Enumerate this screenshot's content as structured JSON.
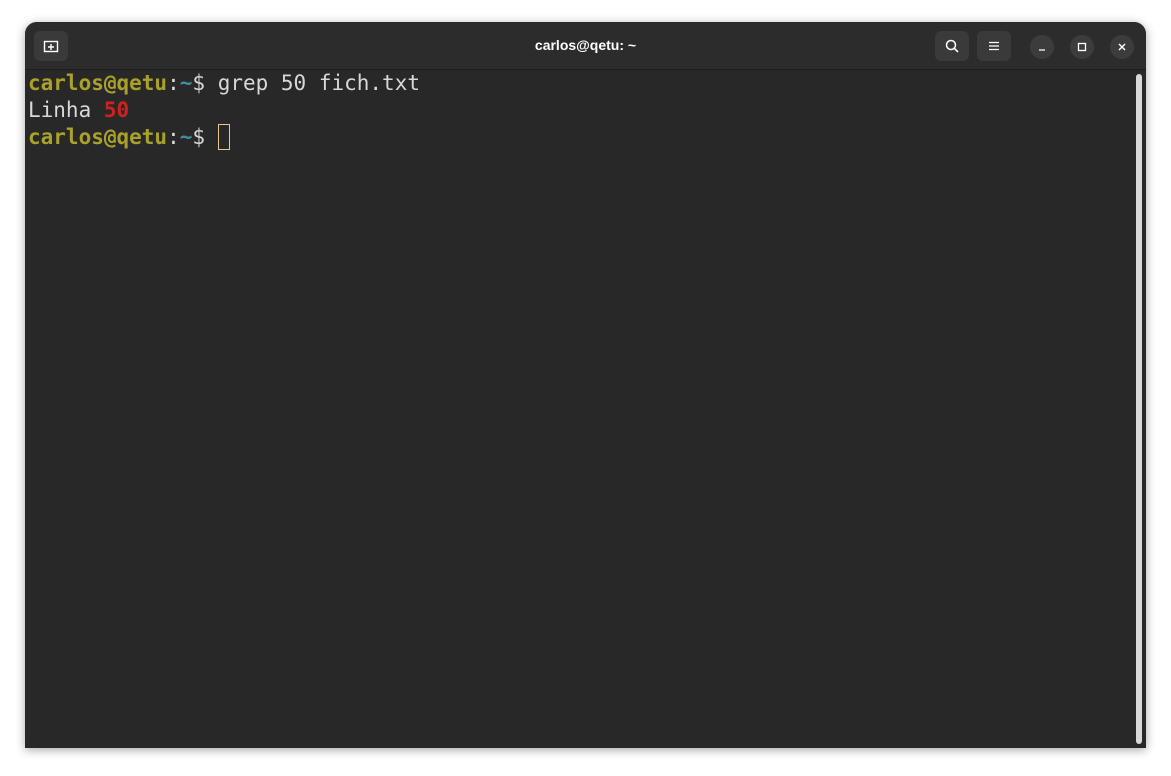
{
  "window": {
    "title": "carlos@qetu: ~"
  },
  "titlebar": {
    "new_tab_icon": "new-tab-icon",
    "search_icon": "search-icon",
    "menu_icon": "hamburger-menu-icon",
    "minimize_icon": "minimize-icon",
    "maximize_icon": "maximize-icon",
    "close_icon": "close-icon"
  },
  "terminal": {
    "lines": [
      {
        "user_host": "carlos@qetu",
        "sep": ":",
        "path": "~",
        "prompt": "$ ",
        "command": "grep 50 fich.txt"
      },
      {
        "output_prefix": "Linha ",
        "output_match": "50"
      },
      {
        "user_host": "carlos@qetu",
        "sep": ":",
        "path": "~",
        "prompt": "$ ",
        "command": ""
      }
    ]
  },
  "colors": {
    "background": "#282828",
    "user_host": "#a9a12a",
    "path": "#3f8f9d",
    "match": "#d02020",
    "text": "#d8d8d8"
  }
}
